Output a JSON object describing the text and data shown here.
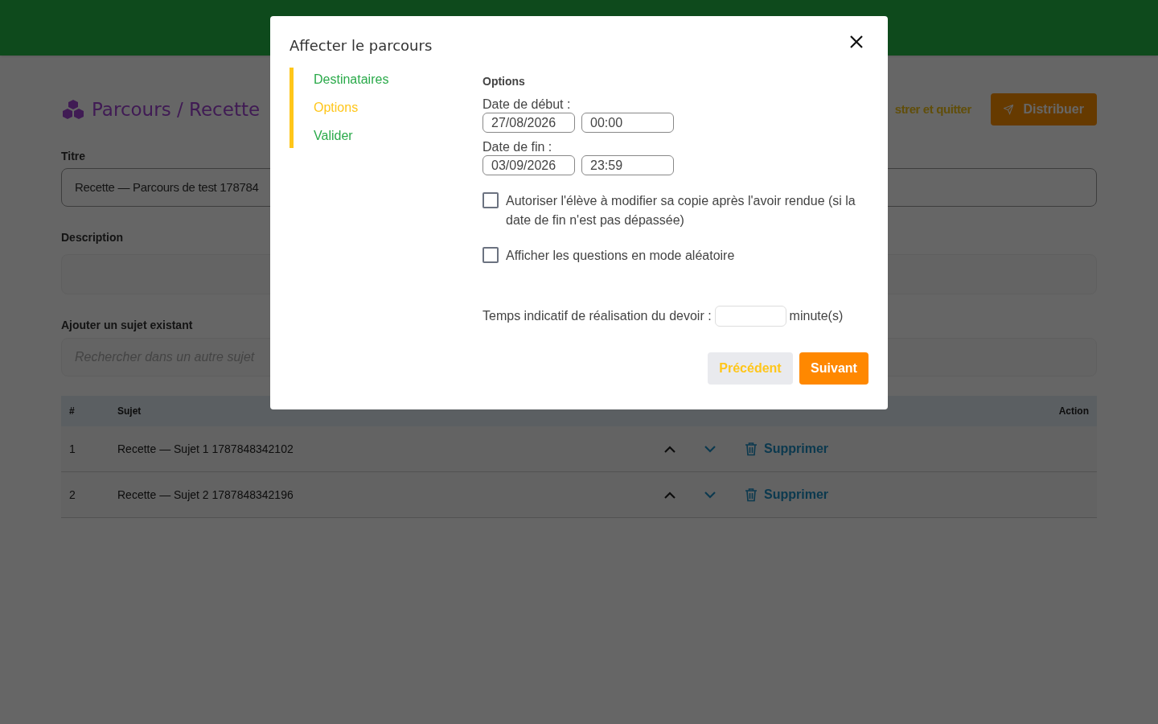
{
  "page": {
    "title": "Parcours / Recette",
    "save_quit": "strer et quitter",
    "distribute": "Distribuer",
    "title_field": {
      "label": "Titre",
      "value": "Recette — Parcours de test 178784"
    },
    "description_field": {
      "label": "Description"
    },
    "search_field": {
      "label": "Ajouter un sujet existant",
      "placeholder": "Rechercher dans un autre sujet"
    },
    "table": {
      "columns": [
        "#",
        "Sujet",
        "Action"
      ],
      "rows": [
        {
          "index": "1",
          "subject": "Recette — Sujet 1 1787848342102",
          "delete": "Supprimer"
        },
        {
          "index": "2",
          "subject": "Recette — Sujet 2 1787848342196",
          "delete": "Supprimer"
        }
      ]
    }
  },
  "modal": {
    "title": "Affecter le parcours",
    "steps": [
      {
        "label": "Destinataires",
        "selected": false
      },
      {
        "label": "Options",
        "selected": true
      },
      {
        "label": "Valider",
        "selected": false
      }
    ],
    "section": "Options",
    "start": {
      "label": "Date de début :",
      "date": "27/08/2026",
      "time": "00:00"
    },
    "end": {
      "label": "Date de fin :",
      "date": "03/09/2026",
      "time": "23:59"
    },
    "checkboxes": [
      {
        "label": "Autoriser l'élève à modifier sa copie après l'avoir rendue (si la date de fin n'est pas dépassée)",
        "checked": false
      },
      {
        "label": "Afficher les questions en mode aléatoire",
        "checked": false
      }
    ],
    "duration": {
      "label": "Temps indicatif de réalisation du devoir :",
      "unit": "minute(s)"
    },
    "previous": "Précédent",
    "next": "Suivant"
  }
}
